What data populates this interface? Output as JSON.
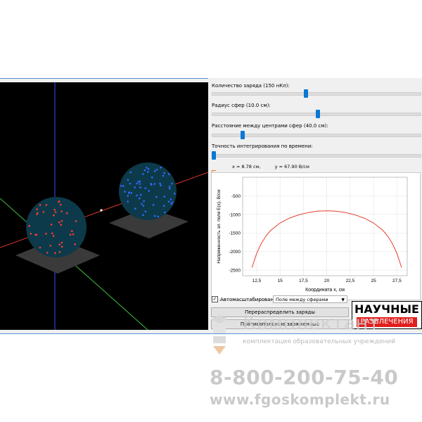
{
  "controls": {
    "charge_label": "Количество заряда (150 нКл):",
    "radius_label": "Радиус сфер (10.0 см):",
    "distance_label": "Расстояние между центрами сфер (40.0 см):",
    "precision_label": "Точность интегрирования по времени:",
    "charge_slider": 0.45,
    "radius_slider": 0.51,
    "distance_slider": 0.14,
    "precision_slider": 0.0
  },
  "readout": {
    "x_text": "x =  8.78 см,",
    "y_text": "y = 67.90 В/см"
  },
  "chart_data": {
    "type": "line",
    "title": "",
    "xlabel": "Координата x, см",
    "ylabel": "Напряженность эл. поля E(x), В/см",
    "xlim": [
      11.0,
      28.6
    ],
    "ylim": [
      -2650,
      0
    ],
    "xticks": [
      "12,5",
      "15",
      "17,5",
      "20",
      "22,5",
      "25",
      "27,5"
    ],
    "xtick_values": [
      12.5,
      15,
      17.5,
      20,
      22.5,
      25,
      27.5
    ],
    "yticks": [
      "-500",
      "-1000",
      "-1500",
      "-2000",
      "-2500"
    ],
    "ytick_values": [
      -500,
      -1000,
      -1500,
      -2000,
      -2500
    ],
    "grid": true,
    "color": "#e8402f",
    "series": [
      {
        "name": "",
        "x": [
          12.0,
          12.5,
          13.0,
          13.5,
          14.0,
          15.0,
          16.0,
          17.0,
          18.0,
          19.0,
          20.0,
          21.0,
          22.0,
          23.0,
          24.0,
          25.0,
          26.0,
          26.5,
          27.0,
          27.5,
          28.0
        ],
        "y": [
          -2430,
          -2050,
          -1780,
          -1580,
          -1430,
          -1230,
          -1100,
          -1010,
          -950,
          -915,
          -905,
          -915,
          -950,
          -1010,
          -1100,
          -1230,
          -1430,
          -1580,
          -1780,
          -2050,
          -2430
        ]
      }
    ]
  },
  "bottom": {
    "autoscale_label": "Автомасштабирование",
    "autoscale_checked": "✓",
    "mode_select": "Поле между сферами",
    "redistribute_button": "Перераспределить заряды",
    "opposite_button": "Противоположно заряженные"
  },
  "brand": {
    "line1": "НАУЧНЫЕ",
    "line2": "РАЗВЛЕЧЕНИЯ"
  },
  "watermark": {
    "name": "Комплектант",
    "tagline": "комплектация образовательных учреждений",
    "phone": "8-800-200-75-40",
    "site": "www.fgoskomplekt.ru"
  },
  "colors": {
    "slider_handle": "#0a78d4",
    "sphere_fill": "#0d3a4a",
    "charge_left": "#ff3b30",
    "charge_right": "#2f6bff",
    "axis_red": "#d8352a",
    "axis_green": "#3fbf3f",
    "axis_blue": "#2a4fff"
  }
}
